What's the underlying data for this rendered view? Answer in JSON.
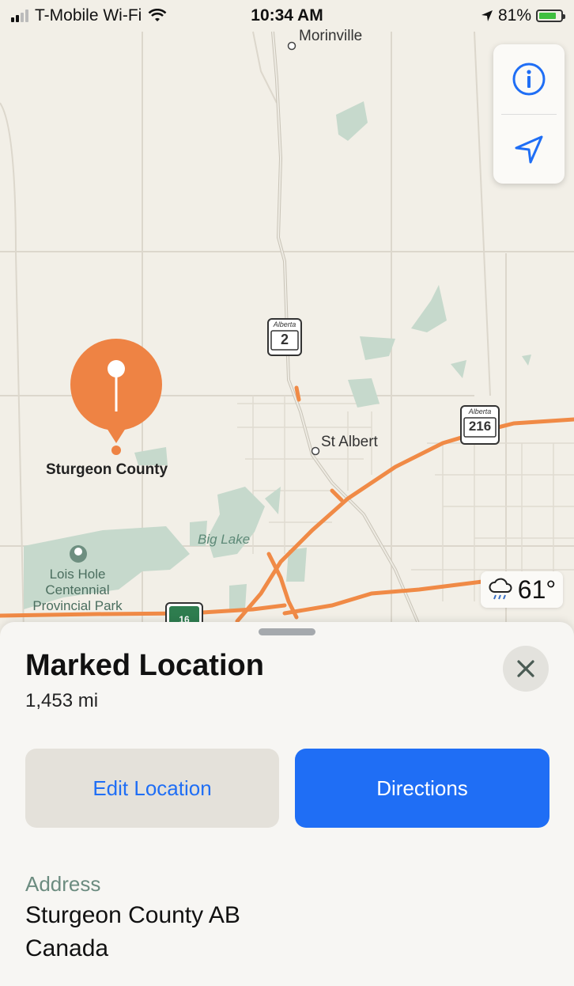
{
  "status_bar": {
    "carrier": "T-Mobile Wi-Fi",
    "time": "10:34 AM",
    "battery": "81%",
    "battery_level": 0.81,
    "icons": [
      "signal-bars-icon",
      "wifi-icon",
      "location-arrow-icon",
      "battery-charging-icon"
    ]
  },
  "map": {
    "labels": {
      "morinville": "Morinville",
      "st_albert": "St Albert",
      "sturgeon_county": "Sturgeon County",
      "big_lake": "Big Lake",
      "park_line1": "Lois Hole",
      "park_line2": "Centennial",
      "park_line3": "Provincial Park"
    },
    "shields": {
      "hwy2": "2",
      "hwy216": "216",
      "hwy16": "16",
      "province_text": "Alberta"
    },
    "controls": [
      "info-icon",
      "location-arrow-icon"
    ],
    "weather": {
      "icon": "rain-cloud-icon",
      "temp": "61°"
    },
    "colors": {
      "land": "#f2efe7",
      "park": "#c6d9cc",
      "highway": "#f08a46",
      "road": "#d8d3c8",
      "pin": "#ee8344"
    }
  },
  "sheet": {
    "title": "Marked Location",
    "distance": "1,453 mi",
    "edit_label": "Edit Location",
    "directions_label": "Directions",
    "address_label": "Address",
    "address_line1": "Sturgeon County AB",
    "address_line2": "Canada",
    "accent": "#1f6ef5"
  }
}
